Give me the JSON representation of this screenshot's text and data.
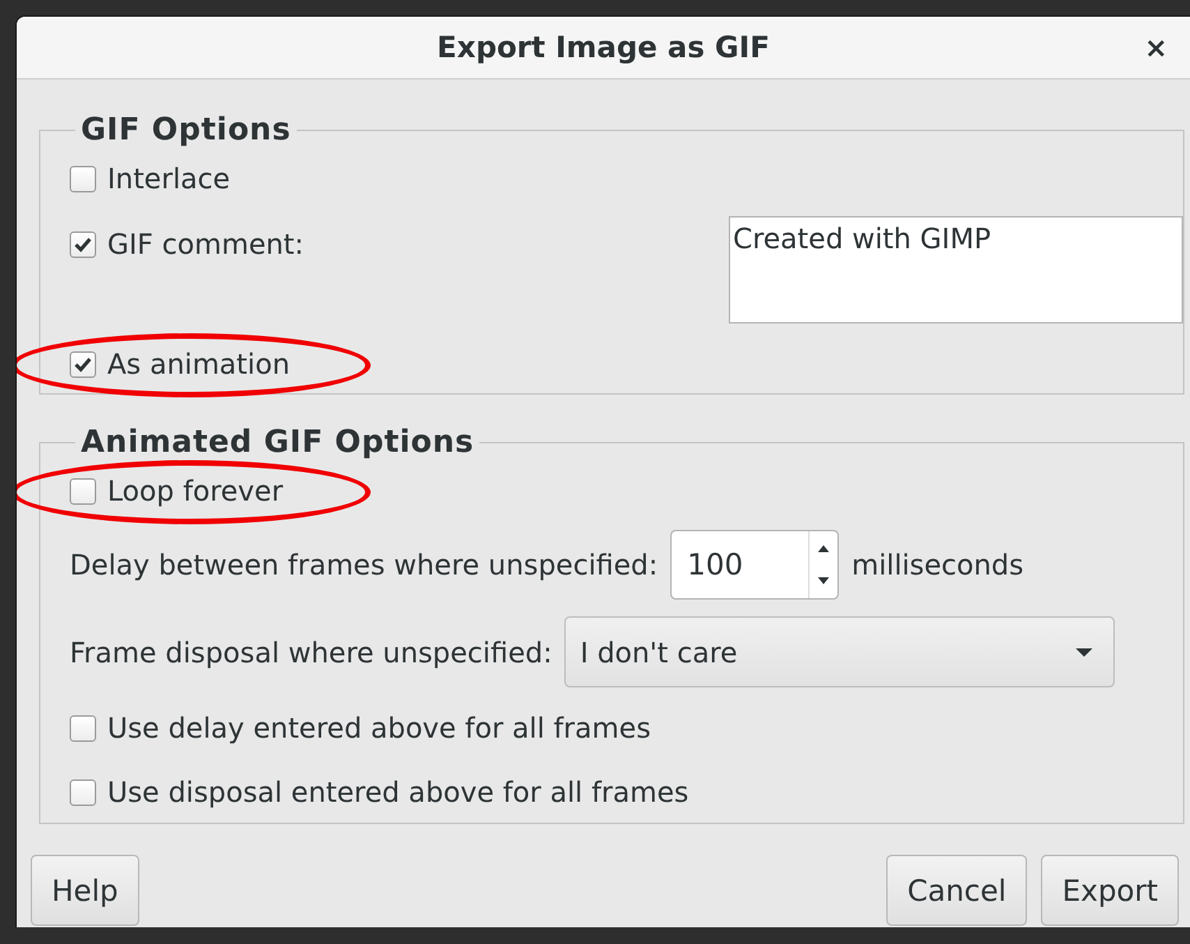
{
  "window": {
    "title": "Export Image as GIF",
    "close": "×"
  },
  "gif_options": {
    "title": "GIF Options",
    "interlace": {
      "label": "Interlace",
      "checked": false,
      "highlighted": false
    },
    "gif_comment": {
      "label": "GIF comment:",
      "checked": true,
      "highlighted": false,
      "value": "Created with GIMP"
    },
    "as_animation": {
      "label": "As animation",
      "checked": true,
      "highlighted": true
    }
  },
  "animated_gif_options": {
    "title": "Animated GIF Options",
    "loop_forever": {
      "label": "Loop forever",
      "checked": false,
      "highlighted": true
    },
    "delay": {
      "label": "Delay between frames where unspecified:",
      "value": "100",
      "unit": "milliseconds"
    },
    "disposal": {
      "label": "Frame disposal where unspecified:",
      "value": "I don't care"
    },
    "use_delay": {
      "label": "Use delay entered above for all frames",
      "checked": false,
      "highlighted": false
    },
    "use_disposal": {
      "label": "Use disposal entered above for all frames",
      "checked": false,
      "highlighted": false
    }
  },
  "buttons_left": [
    {
      "label": "Help"
    }
  ],
  "buttons_right": [
    {
      "label": "Cancel"
    },
    {
      "label": "Export"
    }
  ]
}
